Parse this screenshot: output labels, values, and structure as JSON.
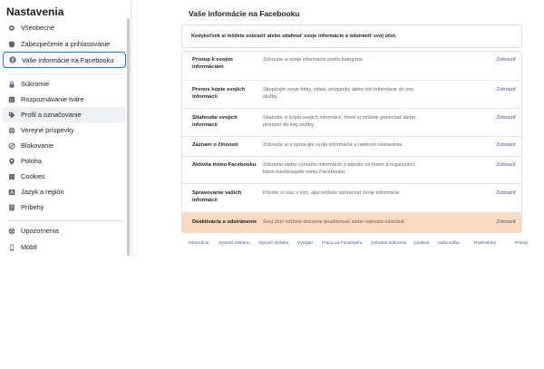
{
  "sidebar": {
    "title": "Nastavenia",
    "items": [
      {
        "label": "Všeobecné",
        "icon": "gear-icon"
      },
      {
        "label": "Zabezpečenie a prihlasovanie",
        "icon": "shield-icon"
      },
      {
        "label": "Vaše informácie na Facebooku",
        "icon": "facebook-icon"
      },
      {
        "label": "Súkromie",
        "icon": "lock-icon"
      },
      {
        "label": "Rozpoznávanie tváre",
        "icon": "face-recognition-icon"
      },
      {
        "label": "Profil a označovanie",
        "icon": "tag-icon"
      },
      {
        "label": "Verejné príspevky",
        "icon": "globe-icon"
      },
      {
        "label": "Blokovanie",
        "icon": "block-icon"
      },
      {
        "label": "Poloha",
        "icon": "location-pin-icon"
      },
      {
        "label": "Cookies",
        "icon": "cookie-icon"
      },
      {
        "label": "Jazyk a región",
        "icon": "language-icon"
      },
      {
        "label": "Príbehy",
        "icon": "book-icon"
      },
      {
        "label": "Upozornenia",
        "icon": "globe-notification-icon"
      },
      {
        "label": "Mobil",
        "icon": "phone-icon"
      }
    ]
  },
  "main": {
    "title": "Vaše informácie na Facebooku",
    "intro": "Kedykoľvek si môžete zobraziť alebo stiahnuť svoje informácie a odstrániť svoj účet.",
    "rows": [
      {
        "label": "Prístup k svojim informáciám",
        "desc": "Zobrazte si svoje informácie podľa kategórie.",
        "action": "Zobraziť"
      },
      {
        "label": "Prenos kópie svojich informácií",
        "desc": "Skopírujte svoje fotky, videá, príspevky alebo iné informácie do inej služby.",
        "action": "Zobraziť"
      },
      {
        "label": "Stiahnutie svojich informácií",
        "desc": "Stiahnite si kópiu svojich informácií, ktoré si môžete ponechať alebo preniesť do inej služby.",
        "action": "Zobraziť"
      },
      {
        "label": "Záznam o činnosti",
        "desc": "Zobrazte si a spravujte svoje informácie a niektoré nastavenia.",
        "action": "Zobraziť"
      },
      {
        "label": "Aktivita mimo Facebooku",
        "desc": "Zobrazte alebo vymažte informácie o aktivite od firiem a organizácií, ktoré navštevujete mimo Facebooku.",
        "action": "Zobraziť"
      },
      {
        "label": "Spravovanie vašich informácií",
        "desc": "Pozrite si viac o tom, ako môžete spravovať svoje informácie.",
        "action": "Zobraziť"
      },
      {
        "label": "Deaktivácia a odstránenie",
        "desc": "Svoj účet môžete dočasne deaktivovať alebo natrvalo odstrániť.",
        "action": "Zobraziť"
      }
    ]
  },
  "footer": {
    "links": [
      "Informácie",
      "Vytvoriť reklamu",
      "Vytvoriť stránku",
      "Vývojári",
      "Práca na Facebooku",
      "Ochrana súkromia",
      "Cookies",
      "Vaša voľba",
      "Podmienky",
      "Pomoc"
    ]
  },
  "colors": {
    "accent": "#1877f2",
    "link": "#385898",
    "highlight_row": "#fad9c1"
  }
}
